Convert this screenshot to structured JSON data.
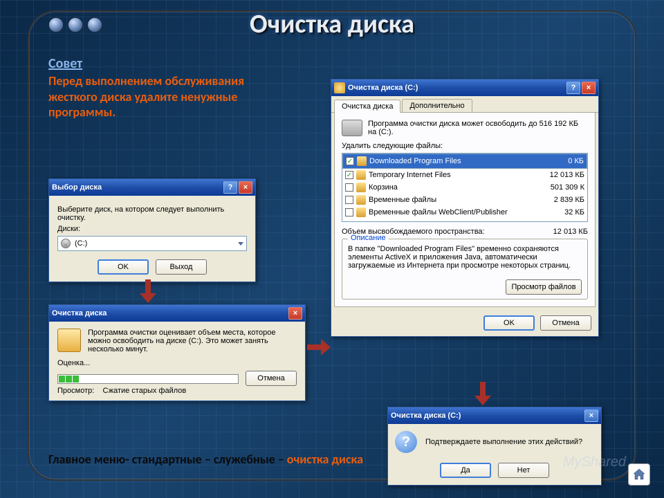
{
  "slide": {
    "title": "Очистка диска",
    "tip_heading": "Совет",
    "tip_body": "Перед выполнением обслуживания жесткого диска удалите ненужные программы.",
    "path_plain": "Главное меню- стандартные – служебные – ",
    "path_accent": "очистка диска",
    "watermark": "MyShared"
  },
  "select_dialog": {
    "title": "Выбор диска",
    "prompt": "Выберите диск, на котором следует выполнить очистку.",
    "field_label": "Диски:",
    "value": "(C:)",
    "ok": "OK",
    "exit": "Выход"
  },
  "progress_dialog": {
    "title": "Очистка диска",
    "message": "Программа очистки оценивает объем места, которое можно освободить на диске (C:). Это может занять несколько минут.",
    "stage_label": "Оценка...",
    "scan_label": "Просмотр:",
    "scan_value": "Сжатие старых файлов",
    "cancel": "Отмена"
  },
  "cleanup_dialog": {
    "title": "Очистка диска (C:)",
    "tab1": "Очистка диска",
    "tab2": "Дополнительно",
    "intro": "Программа очистки диска может освободить до 516 192 КБ на (C:).",
    "list_label": "Удалить следующие файлы:",
    "items": [
      {
        "checked": true,
        "name": "Downloaded Program Files",
        "size": "0 КБ",
        "selected": true
      },
      {
        "checked": true,
        "name": "Temporary Internet Files",
        "size": "12 013 КБ",
        "selected": false
      },
      {
        "checked": false,
        "name": "Корзина",
        "size": "501 309 К",
        "selected": false
      },
      {
        "checked": false,
        "name": "Временные файлы",
        "size": "2 839 КБ",
        "selected": false
      },
      {
        "checked": false,
        "name": "Временные файлы WebClient/Publisher",
        "size": "32 КБ",
        "selected": false
      }
    ],
    "free_label": "Объем высвобождаемого пространства:",
    "free_value": "12 013 КБ",
    "desc_heading": "Описание",
    "desc_body": "В папке \"Downloaded Program Files\" временно сохраняются элементы ActiveX и приложения Java, автоматически загружаемые из Интернета при просмотре некоторых страниц.",
    "view_files": "Просмотр файлов",
    "ok": "OK",
    "cancel": "Отмена"
  },
  "confirm_dialog": {
    "title": "Очистка диска (C:)",
    "message": "Подтверждаете выполнение этих действий?",
    "yes": "Да",
    "no": "Нет"
  }
}
